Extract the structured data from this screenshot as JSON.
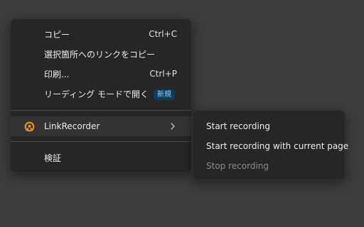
{
  "context_menu": {
    "items": [
      {
        "label": "コピー",
        "shortcut": "Ctrl+C"
      },
      {
        "label": "選択箇所へのリンクをコピー",
        "shortcut": ""
      },
      {
        "label": "印刷...",
        "shortcut": "Ctrl+P"
      },
      {
        "label": "リーディング モードで開く",
        "badge": "新規"
      }
    ],
    "extension": {
      "label": "LinkRecorder",
      "icon": "link-recorder-icon"
    },
    "inspect": {
      "label": "検証"
    }
  },
  "submenu": {
    "items": [
      {
        "label": "Start recording",
        "enabled": true
      },
      {
        "label": "Start recording with current page",
        "enabled": true
      },
      {
        "label": "Stop recording",
        "enabled": false
      }
    ]
  },
  "colors": {
    "menu_background": "#262626",
    "page_background": "#3c3c3c",
    "badge_background": "#0c3d5d",
    "badge_text": "#9fd0f5",
    "extension_icon": "#e8912d",
    "disabled_text": "#8a8a8a"
  }
}
